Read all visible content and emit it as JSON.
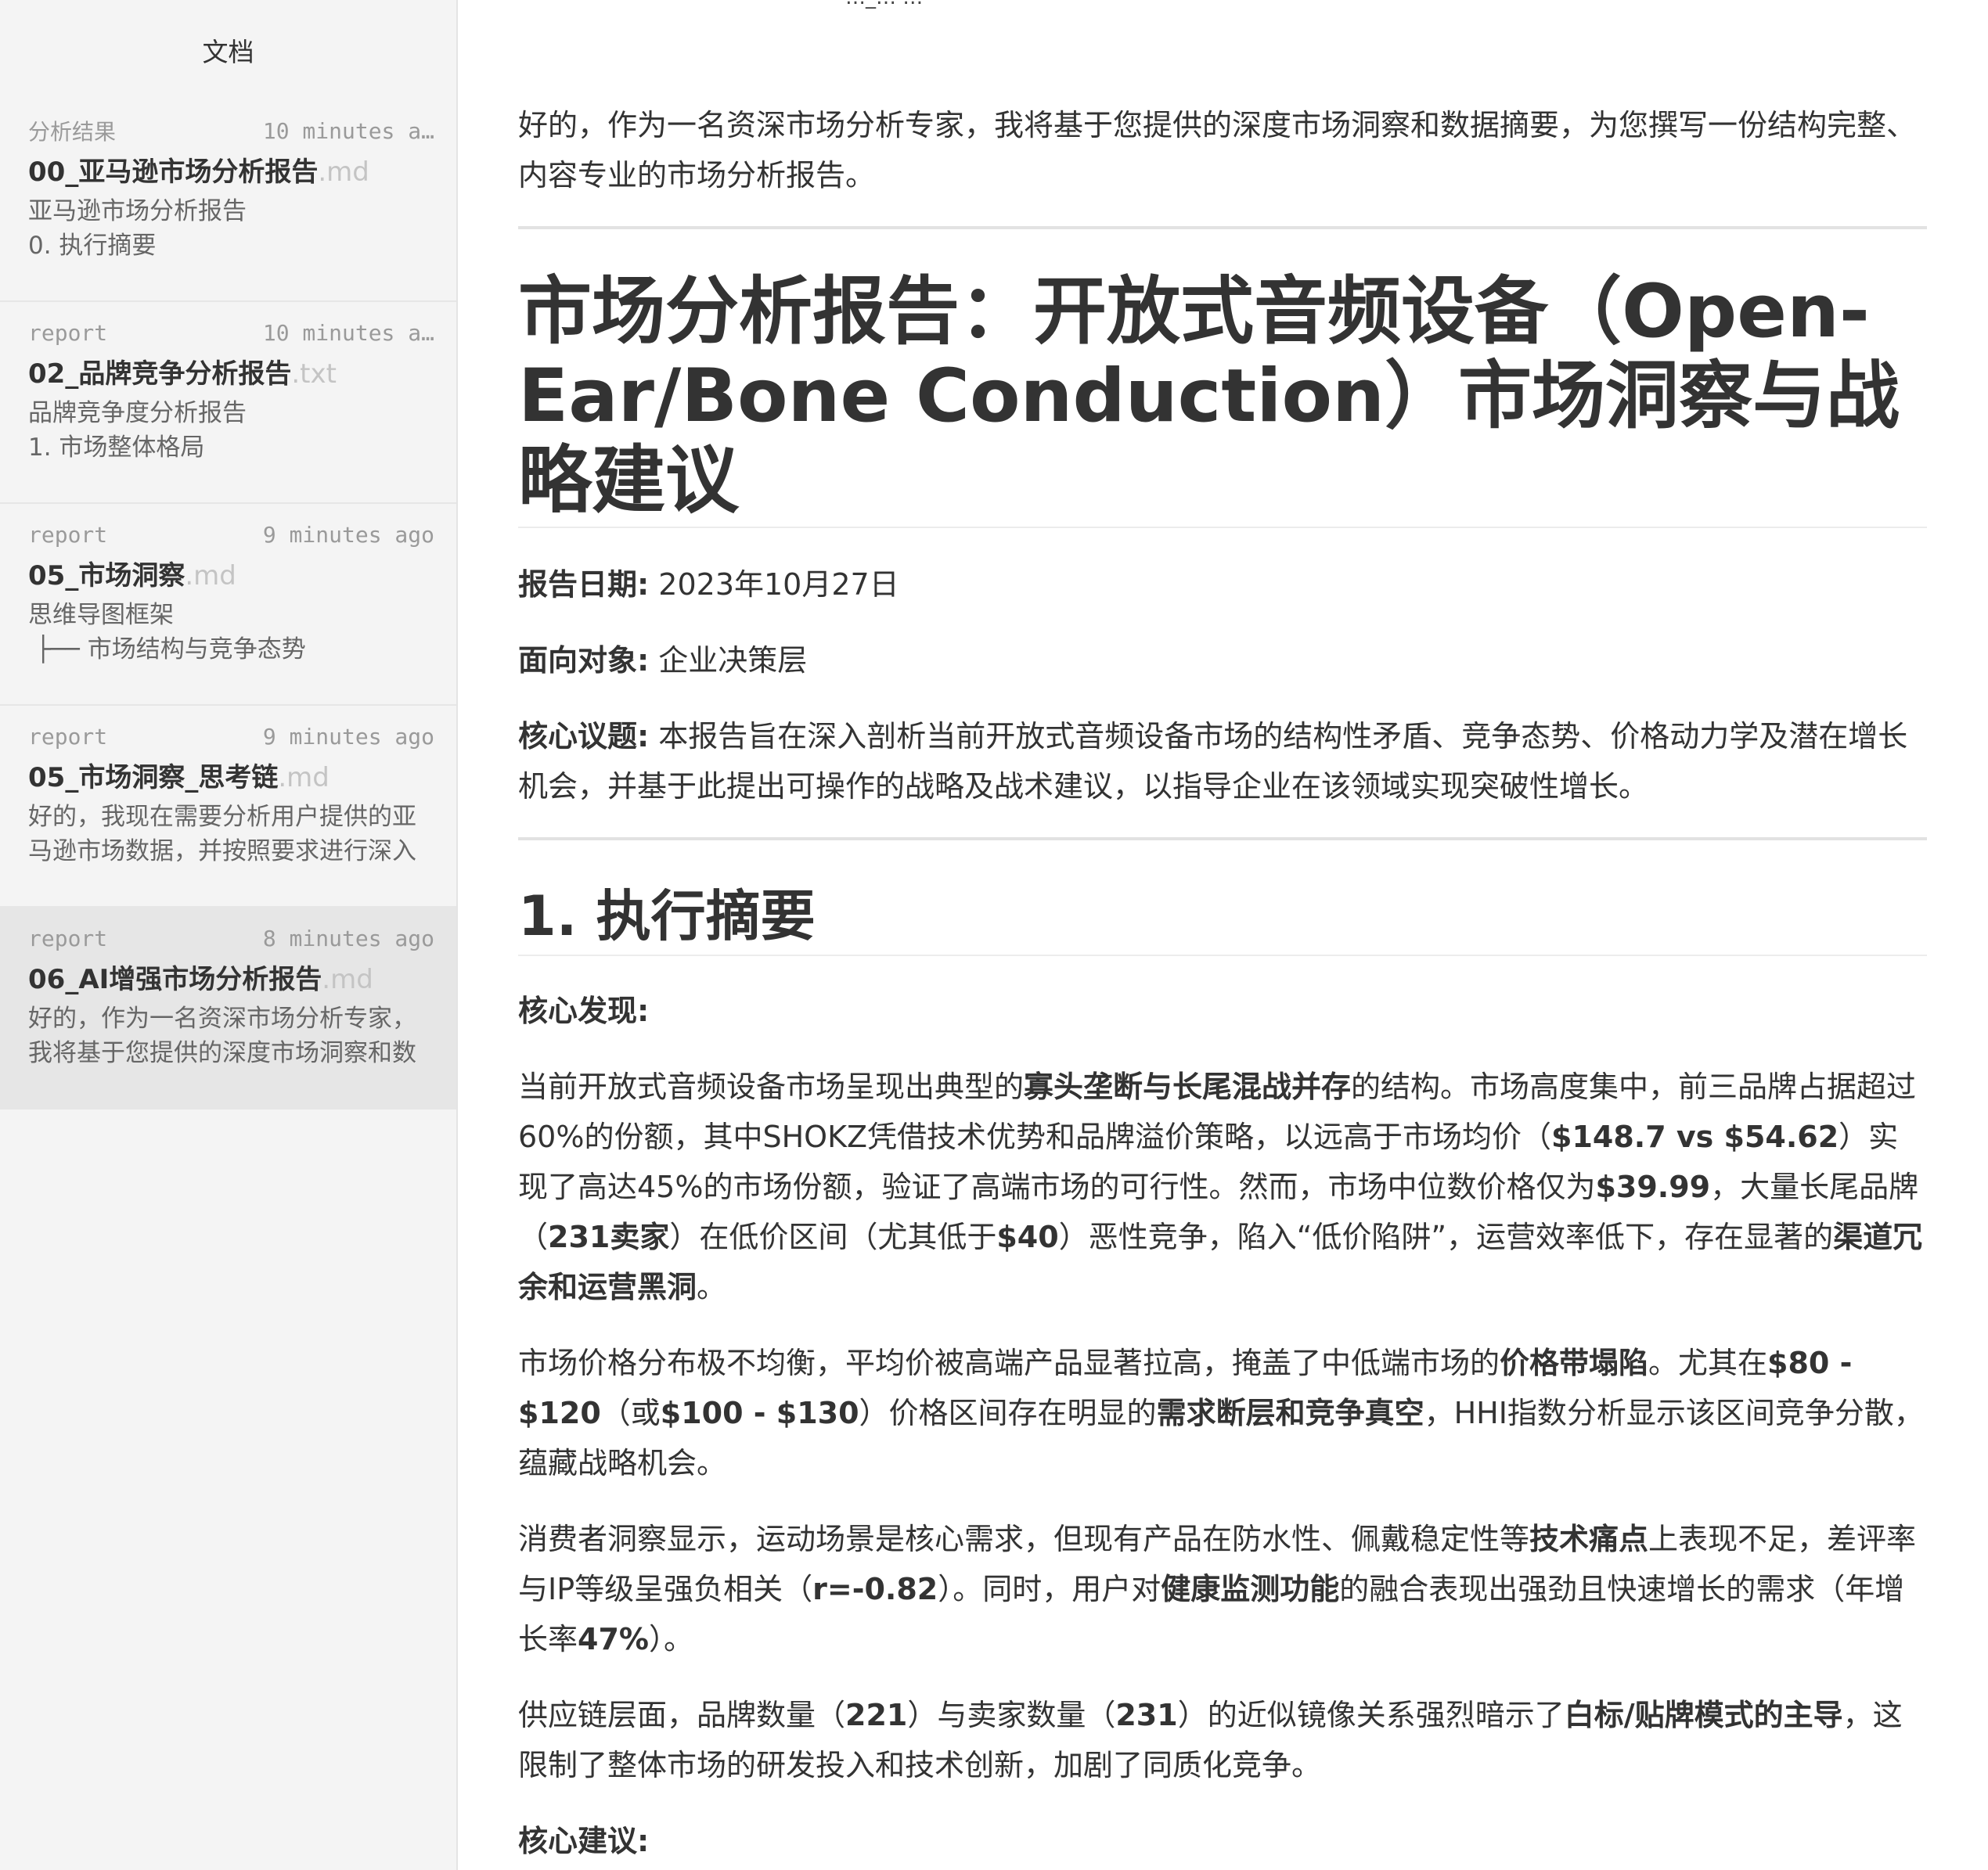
{
  "window": {
    "title": "…_…  …"
  },
  "sidebar": {
    "title": "文档",
    "items": [
      {
        "folder": "分析结果",
        "time": "10 minutes a…",
        "name": "00_亚马逊市场分析报告",
        "ext": ".md",
        "preview": "亚马逊市场分析报告\n0. 执行摘要",
        "active": false
      },
      {
        "folder": "report",
        "time": "10 minutes a…",
        "name": "02_品牌竞争分析报告",
        "ext": ".txt",
        "preview": "品牌竞争度分析报告\n1. 市场整体格局",
        "active": false
      },
      {
        "folder": "report",
        "time": "9 minutes ago",
        "name": "05_市场洞察",
        "ext": ".md",
        "preview": "思维导图框架\n ├── 市场结构与竞争态势",
        "active": false
      },
      {
        "folder": "report",
        "time": "9 minutes ago",
        "name": "05_市场洞察_思考链",
        "ext": ".md",
        "preview": "好的，我现在需要分析用户提供的亚马逊市场数据，并按照要求进行深入",
        "active": false
      },
      {
        "folder": "report",
        "time": "8 minutes ago",
        "name": "06_AI增强市场分析报告",
        "ext": ".md",
        "preview": "好的，作为一名资深市场分析专家，我将基于您提供的深度市场洞察和数",
        "active": true
      }
    ]
  },
  "doc": {
    "intro": "好的，作为一名资深市场分析专家，我将基于您提供的深度市场洞察和数据摘要，为您撰写一份结构完整、内容专业的市场分析报告。",
    "title": "市场分析报告：开放式音频设备（Open-Ear/Bone Conduction）市场洞察与战略建议",
    "meta": [
      {
        "label": "报告日期:",
        "value": " 2023年10月27日"
      },
      {
        "label": "面向对象:",
        "value": " 企业决策层"
      },
      {
        "label": "核心议题:",
        "value": " 本报告旨在深入剖析当前开放式音频设备市场的结构性矛盾、竞争态势、价格动力学及潜在增长机会，并基于此提出可操作的战略及战术建议，以指导企业在该领域实现突破性增长。"
      }
    ],
    "section1_title": "1. 执行摘要",
    "findings_label": "核心发现:",
    "p1": [
      {
        "t": "当前开放式音频设备市场呈现出典型的"
      },
      {
        "t": "寡头垄断与长尾混战并存",
        "b": true
      },
      {
        "t": "的结构。市场高度集中，前三品牌占据超过60%的份额，其中SHOKZ凭借技术优势和品牌溢价策略，以远高于市场均价（"
      },
      {
        "t": "$148.7 vs $54.62",
        "b": true
      },
      {
        "t": "）实现了高达45%的市场份额，验证了高端市场的可行性。然而，市场中位数价格仅为"
      },
      {
        "t": "$39.99",
        "b": true
      },
      {
        "t": "，大量长尾品牌（"
      },
      {
        "t": "231卖家",
        "b": true
      },
      {
        "t": "）在低价区间（尤其低于"
      },
      {
        "t": "$40",
        "b": true
      },
      {
        "t": "）恶性竞争，陷入“低价陷阱”，运营效率低下，存在显著的"
      },
      {
        "t": "渠道冗余和运营黑洞",
        "b": true
      },
      {
        "t": "。"
      }
    ],
    "p2": [
      {
        "t": "市场价格分布极不均衡，平均价被高端产品显著拉高，掩盖了中低端市场的"
      },
      {
        "t": "价格带塌陷",
        "b": true
      },
      {
        "t": "。尤其在"
      },
      {
        "t": "$80 - $120",
        "b": true
      },
      {
        "t": "（或"
      },
      {
        "t": "$100 - $130",
        "b": true
      },
      {
        "t": "）价格区间存在明显的"
      },
      {
        "t": "需求断层和竞争真空",
        "b": true
      },
      {
        "t": "，HHI指数分析显示该区间竞争分散，蕴藏战略机会。"
      }
    ],
    "p3": [
      {
        "t": "消费者洞察显示，运动场景是核心需求，但现有产品在防水性、佩戴稳定性等"
      },
      {
        "t": "技术痛点",
        "b": true
      },
      {
        "t": "上表现不足，差评率与IP等级呈强负相关（"
      },
      {
        "t": "r=-0.82",
        "b": true
      },
      {
        "t": "）。同时，用户对"
      },
      {
        "t": "健康监测功能",
        "b": true
      },
      {
        "t": "的融合表现出强劲且快速增长的需求（年增长率"
      },
      {
        "t": "47%",
        "b": true
      },
      {
        "t": "）。"
      }
    ],
    "p4": [
      {
        "t": "供应链层面，品牌数量（"
      },
      {
        "t": "221",
        "b": true
      },
      {
        "t": "）与卖家数量（"
      },
      {
        "t": "231",
        "b": true
      },
      {
        "t": "）的近似镜像关系强烈暗示了"
      },
      {
        "t": "白标/贴牌模式的主导",
        "b": true
      },
      {
        "t": "，这限制了整体市场的研发投入和技术创新，加剧了同质化竞争。"
      }
    ],
    "recommendations_label": "核心建议:"
  }
}
